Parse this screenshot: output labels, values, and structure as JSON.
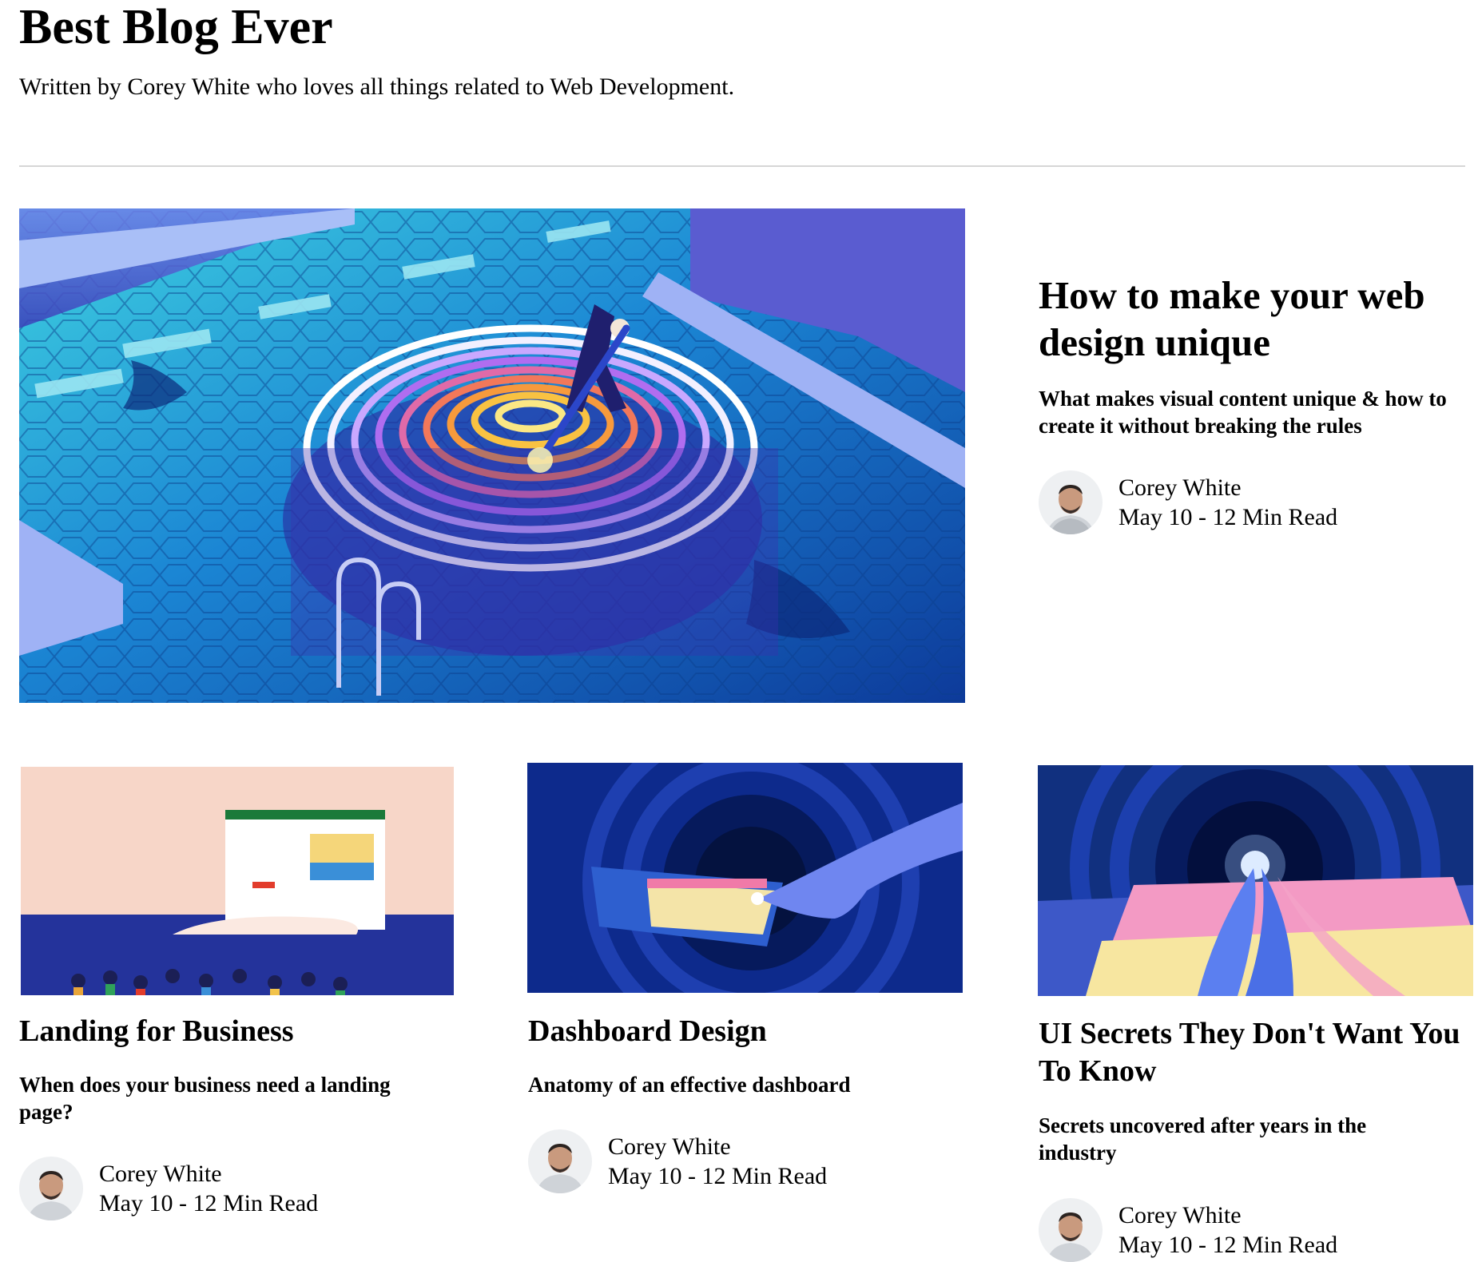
{
  "site": {
    "title": "Best Blog Ever",
    "subtitle": "Written by Corey White who loves all things related to Web Development."
  },
  "featured": {
    "title": "How to make your web design unique",
    "subtitle": "What makes visual content unique & how to create it without breaking the rules",
    "author": "Corey White",
    "meta": "May 10 - 12 Min Read",
    "image_icon": "fingerprint-pool-illustration"
  },
  "posts": [
    {
      "title": "Landing for Business",
      "subtitle": "When does your business need a landing page?",
      "author": "Corey White",
      "meta": "May 10 - 12 Min Read",
      "image_icon": "landing-page-people-illustration"
    },
    {
      "title": "Dashboard Design",
      "subtitle": "Anatomy of an effective dashboard",
      "author": "Corey White",
      "meta": "May 10 - 12 Min Read",
      "image_icon": "dashboard-hand-illustration"
    },
    {
      "title": "UI Secrets They Don't Want You To Know",
      "subtitle": "Secrets uncovered after years in the industry",
      "author": "Corey White",
      "meta": "May 10 - 12 Min Read",
      "image_icon": "ui-portal-illustration"
    }
  ],
  "colors": {
    "divider": "#d6d6d6",
    "pool_blue": "#1a7fd6",
    "navy": "#0a1f6b",
    "peach": "#f7d6c8"
  }
}
